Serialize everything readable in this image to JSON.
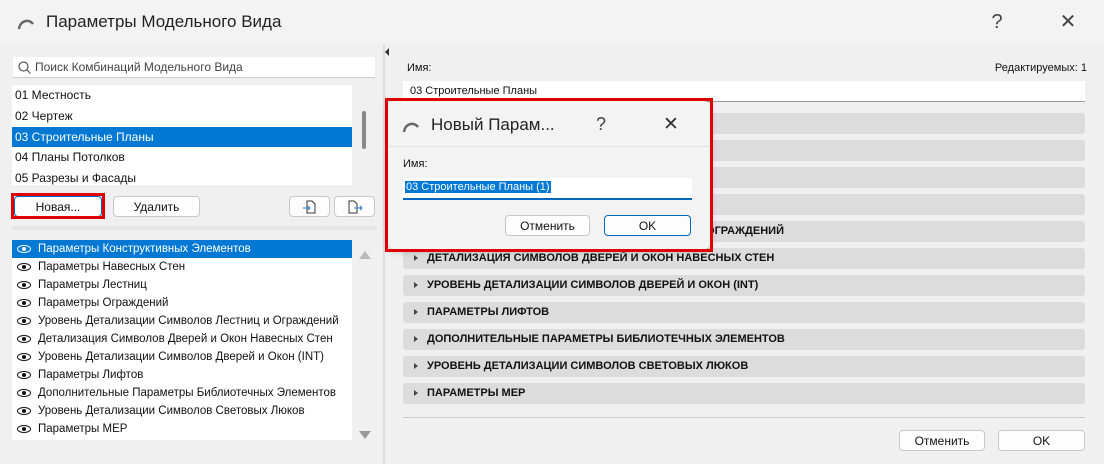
{
  "window": {
    "title": "Параметры Модельного Вида",
    "help": "?",
    "close": "✕"
  },
  "search": {
    "placeholder": "Поиск Комбинаций Модельного Вида"
  },
  "combinations": [
    "01 Местность",
    "02 Чертеж",
    "03 Строительные Планы",
    "04 Планы Потолков",
    "05 Разрезы и Фасады"
  ],
  "selected_combination": "03 Строительные Планы",
  "buttons": {
    "new": "Новая...",
    "delete": "Удалить"
  },
  "options": [
    "Параметры Конструктивных Элементов",
    "Параметры Навесных Стен",
    "Параметры Лестниц",
    "Параметры Ограждений",
    "Уровень Детализации Символов Лестниц и Ограждений",
    "Детализация Символов Дверей и Окон Навесных Стен",
    "Уровень Детализации Символов Дверей и Окон (INT)",
    "Параметры Лифтов",
    "Дополнительные Параметры Библиотечных Элементов",
    "Уровень Детализации Символов Световых Люков",
    "Параметры MEP"
  ],
  "right": {
    "name_label": "Имя:",
    "editable": "Редактируемых: 1",
    "name_value": "03 Строительные Планы",
    "sections": [
      "",
      "",
      "",
      "",
      "УРОВЕНЬ ДЕТАЛИЗАЦИИ СИМВОЛОВ ЛЕСТНИЦ И ОГРАЖДЕНИЙ",
      "ДЕТАЛИЗАЦИЯ СИМВОЛОВ ДВЕРЕЙ И ОКОН НАВЕСНЫХ СТЕН",
      "УРОВЕНЬ ДЕТАЛИЗАЦИИ СИМВОЛОВ ДВЕРЕЙ И ОКОН (INT)",
      "ПАРАМЕТРЫ ЛИФТОВ",
      "ДОПОЛНИТЕЛЬНЫЕ ПАРАМЕТРЫ БИБЛИОТЕЧНЫХ ЭЛЕМЕНТОВ",
      "УРОВЕНЬ ДЕТАЛИЗАЦИИ СИМВОЛОВ СВЕТОВЫХ ЛЮКОВ",
      "ПАРАМЕТРЫ MEP"
    ],
    "cancel": "Отменить",
    "ok": "OK"
  },
  "dialog": {
    "title": "Новый Парам...",
    "help": "?",
    "close": "✕",
    "name_label": "Имя:",
    "name_value": "03 Строительные Планы (1)",
    "cancel": "Отменить",
    "ok": "OK"
  },
  "colors": {
    "accent": "#0078d4",
    "highlight": "#e00000"
  }
}
